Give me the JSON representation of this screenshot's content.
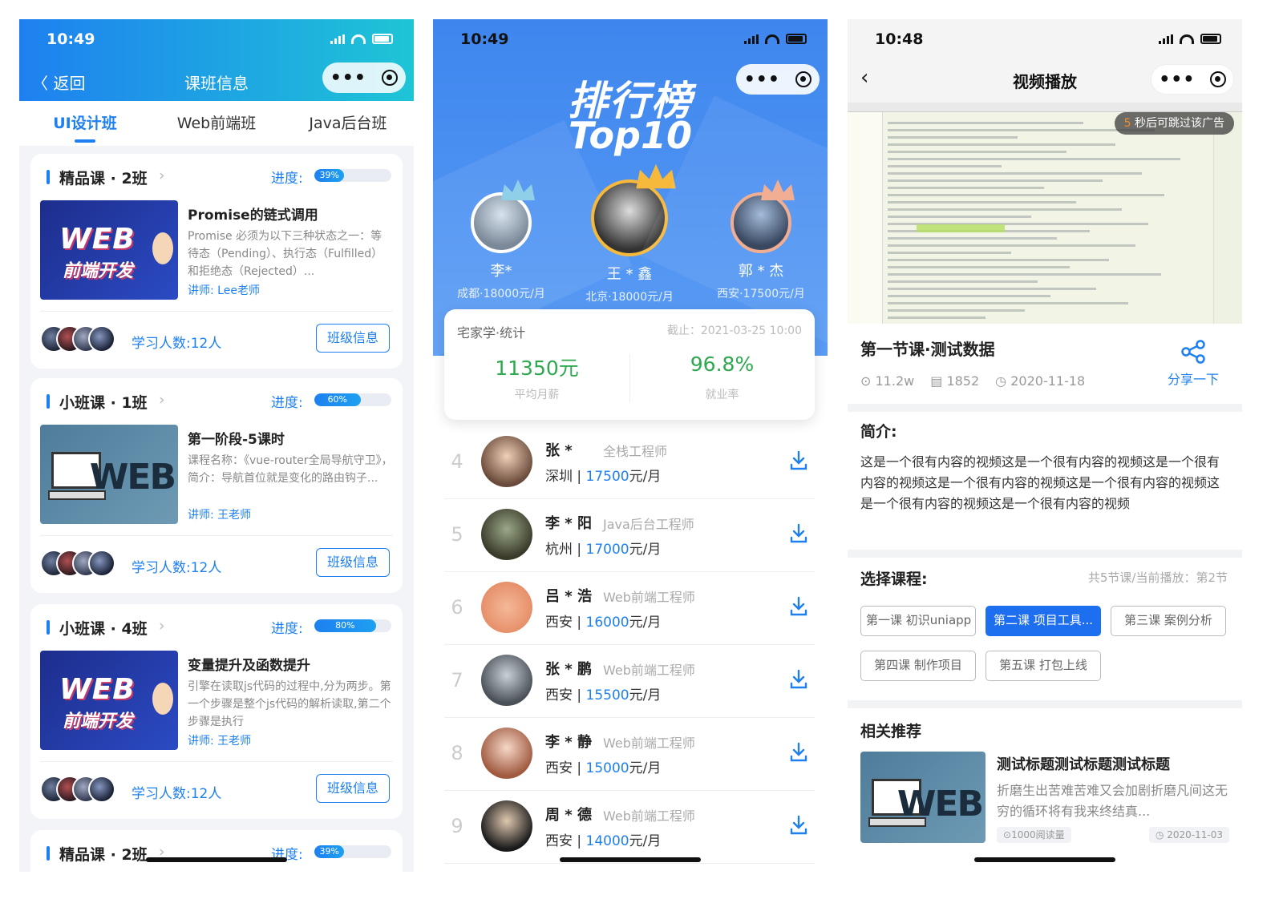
{
  "status": {
    "time1": "10:49",
    "time2": "10:49",
    "time3": "10:48"
  },
  "p1": {
    "back": "返回",
    "title": "课班信息",
    "tabs": [
      "UI设计班",
      "Web前端班",
      "Java后台班"
    ],
    "cards": [
      {
        "name": "精品课 · 2班",
        "progress_label": "进度:",
        "progress": "39%",
        "progress_value": 0.39,
        "course_title": "Promise的链式调用",
        "desc": "Promise 必须为以下三种状态之一：等待态（Pending）、执行态（Fulfilled）和拒绝态（Rejected）...",
        "teacher": "讲师:   Lee老师",
        "students": "学习人数:12人",
        "btn": "班级信息",
        "thumb_text1": "WEB",
        "thumb_text2": "前端开发"
      },
      {
        "name": "小班课 · 1班",
        "progress_label": "进度:",
        "progress": "60%",
        "progress_value": 0.6,
        "course_title": "第一阶段-5课时",
        "desc": "课程名称：《vue-router全局导航守卫》，简介：导航首位就是变化的路由钩子...",
        "teacher": "讲师:   王老师",
        "students": "学习人数:12人",
        "btn": "班级信息",
        "thumb_text1": "WEB"
      },
      {
        "name": "小班课 · 4班",
        "progress_label": "进度:",
        "progress": "80%",
        "progress_value": 0.8,
        "course_title": "变量提升及函数提升",
        "desc": "引擎在读取js代码的过程中,分为两步。第一个步骤是整个js代码的解析读取,第二个步骤是执行",
        "teacher": "讲师:   王老师",
        "students": "学习人数:12人",
        "btn": "班级信息",
        "thumb_text1": "WEB",
        "thumb_text2": "前端开发"
      },
      {
        "name": "精品课 · 2班",
        "progress_label": "进度:",
        "progress": "39%",
        "progress_value": 0.39
      }
    ]
  },
  "p2": {
    "title": "排行榜",
    "subtitle": "Top10",
    "podium": [
      {
        "name": "李*",
        "sub": "成都·18000元/月"
      },
      {
        "name": "王 * 鑫",
        "sub": "北京·18000元/月"
      },
      {
        "name": "郭 * 杰",
        "sub": "西安·17500元/月"
      }
    ],
    "stats": {
      "label": "宅家学·统计",
      "date": "截止：2021-03-25 10:00",
      "value1": "11350元",
      "label1": "平均月薪",
      "value2": "96.8%",
      "label2": "就业率"
    },
    "list": [
      {
        "rank": "4",
        "name": "张 *",
        "job": "全栈工程师",
        "city": "深圳",
        "salary": "17500",
        "unit": "元/月"
      },
      {
        "rank": "5",
        "name": "李 * 阳",
        "job": "Java后台工程师",
        "city": "杭州",
        "salary": "17000",
        "unit": "元/月"
      },
      {
        "rank": "6",
        "name": "吕 * 浩",
        "job": "Web前端工程师",
        "city": "西安",
        "salary": "16000",
        "unit": "元/月"
      },
      {
        "rank": "7",
        "name": "张 * 鹏",
        "job": "Web前端工程师",
        "city": "西安",
        "salary": "15500",
        "unit": "元/月"
      },
      {
        "rank": "8",
        "name": "李 * 静",
        "job": "Web前端工程师",
        "city": "西安",
        "salary": "15000",
        "unit": "元/月"
      },
      {
        "rank": "9",
        "name": "周 * 德",
        "job": "Web前端工程师",
        "city": "西安",
        "salary": "14000",
        "unit": "元/月"
      }
    ]
  },
  "p3": {
    "title": "视频播放",
    "skip_num": "5",
    "skip_text": "秒后可跳过该广告",
    "video_title": "第一节课·测试数据",
    "plays": "11.2w",
    "comments": "1852",
    "date": "2020-11-18",
    "share": "分享一下",
    "intro_h": "简介:",
    "intro": "这是一个很有内容的视频这是一个很有内容的视频这是一个很有内容的视频这是一个很有内容的视频这是一个很有内容的视频这是一个很有内容的视频这是一个很有内容的视频",
    "select_h": "选择课程:",
    "select_info": "共5节课/当前播放：第2节",
    "lessons": [
      "第一课 初识uniapp",
      "第二课 项目工具...",
      "第三课 案例分析",
      "第四课 制作项目",
      "第五课 打包上线"
    ],
    "related_h": "相关推荐",
    "related_title": "测试标题测试标题测试标题",
    "related_desc": "折磨生出苦难苦难又会加剧折磨凡间这无穷的循环将有我来终结真...",
    "related_views": "1000阅读量",
    "related_date": "2020-11-03",
    "related_thumb": "WEB"
  }
}
